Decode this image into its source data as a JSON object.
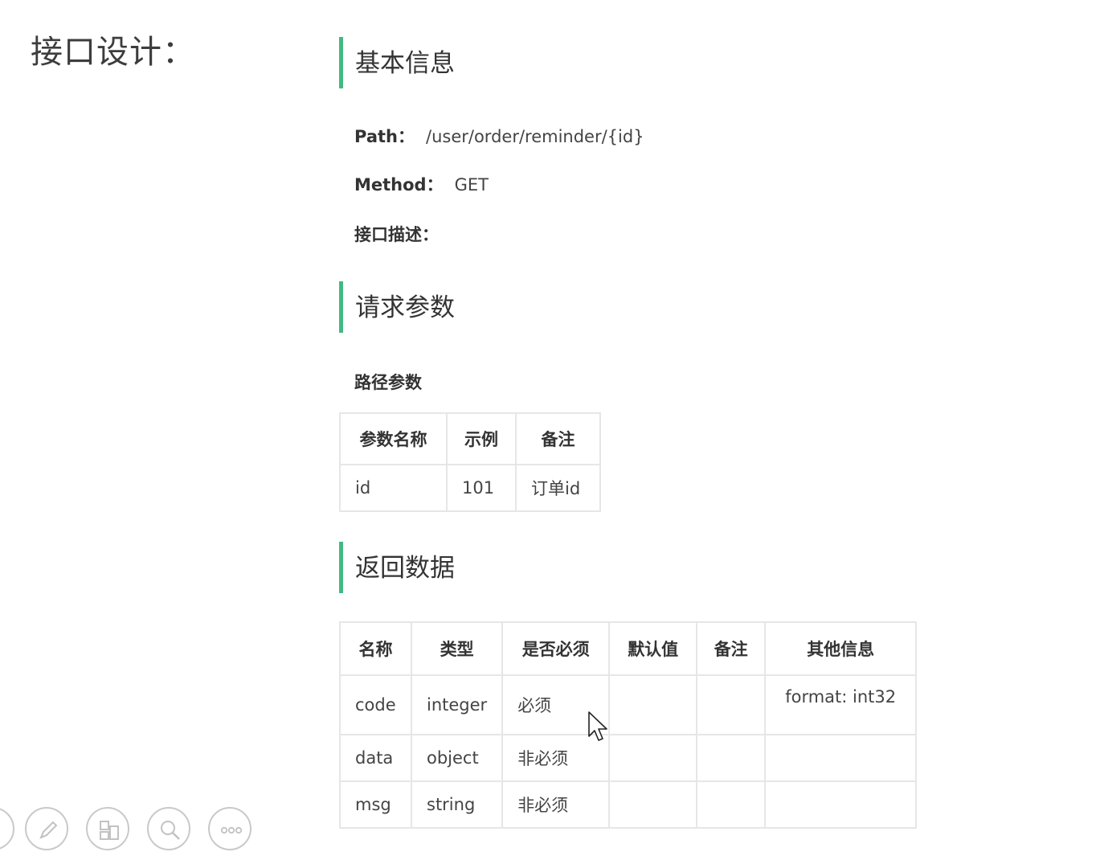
{
  "page": {
    "title": "接口设计："
  },
  "basic": {
    "heading": "基本信息",
    "path_label": "Path：",
    "path_value": "/user/order/reminder/{id}",
    "method_label": "Method：",
    "method_value": "GET",
    "desc_label": "接口描述："
  },
  "request": {
    "heading": "请求参数",
    "subheading": "路径参数",
    "columns": [
      "参数名称",
      "示例",
      "备注"
    ],
    "rows": [
      [
        "id",
        "101",
        "订单id"
      ]
    ]
  },
  "response": {
    "heading": "返回数据",
    "columns": [
      "名称",
      "类型",
      "是否必须",
      "默认值",
      "备注",
      "其他信息"
    ],
    "rows": [
      [
        "code",
        "integer",
        "必须",
        "",
        "",
        "format: int32"
      ],
      [
        "data",
        "object",
        "非必须",
        "",
        "",
        ""
      ],
      [
        "msg",
        "string",
        "非必须",
        "",
        "",
        ""
      ]
    ]
  },
  "toolbar": {
    "icons": [
      "pen-icon",
      "layout-icon",
      "zoom-icon",
      "more-icon"
    ]
  }
}
